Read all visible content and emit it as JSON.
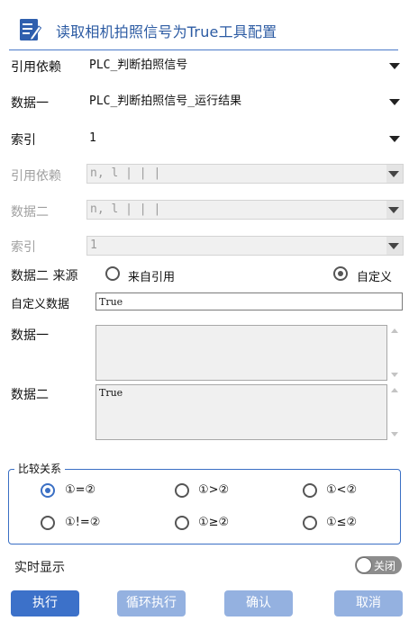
{
  "title": "读取相机拍照信号为True工具配置",
  "rows": [
    {
      "label": "引用依赖",
      "value": "PLC_判断拍照信号",
      "disabled": false
    },
    {
      "label": "数据一",
      "value": "PLC_判断拍照信号_运行结果",
      "disabled": false
    },
    {
      "label": "索引",
      "value": "1",
      "disabled": false
    },
    {
      "label": "引用依赖",
      "value": "n, l | | |",
      "disabled": true
    },
    {
      "label": "数据二",
      "value": "n, l | | |",
      "disabled": true
    },
    {
      "label": "索引",
      "value": "1",
      "disabled": true
    }
  ],
  "source": {
    "label": "数据二 来源",
    "options": [
      {
        "label": "来自引用",
        "checked": false
      },
      {
        "label": "自定义",
        "checked": true
      }
    ]
  },
  "custom_data": {
    "label": "自定义数据",
    "value": "True"
  },
  "data_one": {
    "label": "数据一",
    "value": ""
  },
  "data_two": {
    "label": "数据二",
    "value": "True"
  },
  "comparison": {
    "title": "比较关系",
    "options": [
      {
        "label": "①=②",
        "checked": true
      },
      {
        "label": "①>②",
        "checked": false
      },
      {
        "label": "①<②",
        "checked": false
      },
      {
        "label": "①!=②",
        "checked": false
      },
      {
        "label": "①≥②",
        "checked": false
      },
      {
        "label": "①≤②",
        "checked": false
      }
    ]
  },
  "realtime": {
    "label": "实时显示",
    "toggle_label": "关闭",
    "on": false
  },
  "buttons": {
    "execute": "执行",
    "loop_execute": "循环执行",
    "confirm": "确认",
    "cancel": "取消"
  },
  "colors": {
    "accent": "#3c71c9",
    "accent_muted": "#94b1e0",
    "title": "#2c5ba3"
  }
}
